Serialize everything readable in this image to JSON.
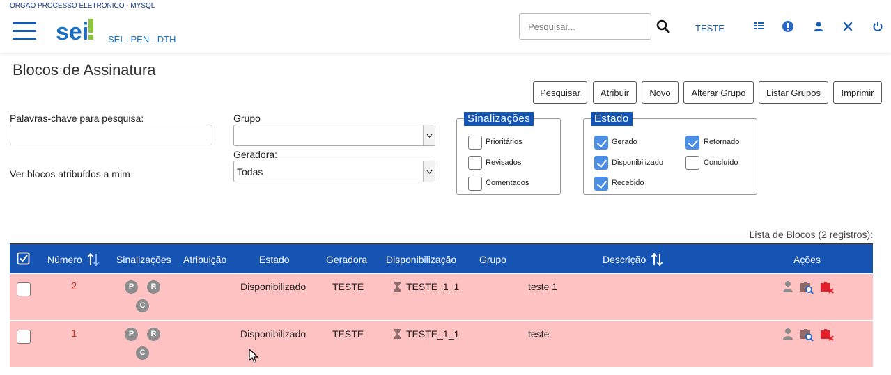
{
  "header": {
    "org": "ORGAO PROCESSO ELETRONICO - MYSQL",
    "logo_text": "sei!",
    "env": "SEI - PEN - DTH",
    "search_placeholder": "Pesquisar...",
    "user": "TESTE",
    "icons": [
      "menu-icon",
      "search-icon",
      "grid-icon",
      "alert-icon",
      "user-icon",
      "tools-icon",
      "power-icon"
    ]
  },
  "page": {
    "title": "Blocos de Assinatura"
  },
  "toolbar": {
    "pesquisar": "Pesquisar",
    "atribuir": "Atribuir",
    "novo": "Novo",
    "alterar_grupo": "Alterar Grupo",
    "listar_grupos": "Listar Grupos",
    "imprimir": "Imprimir"
  },
  "filters": {
    "keywords_label": "Palavras-chave para pesquisa:",
    "keywords_value": "",
    "grupo_label": "Grupo",
    "grupo_value": "",
    "geradora_label": "Geradora:",
    "geradora_value": "Todas",
    "ver_blocos": "Ver blocos atribuídos a mim"
  },
  "sinalizacoes": {
    "legend": "Sinalizações",
    "items": [
      {
        "label": "Prioritários",
        "checked": false
      },
      {
        "label": "Revisados",
        "checked": false
      },
      {
        "label": "Comentados",
        "checked": false
      }
    ]
  },
  "estado": {
    "legend": "Estado",
    "items": [
      {
        "label": "Gerado",
        "checked": true
      },
      {
        "label": "Disponibilizado",
        "checked": true
      },
      {
        "label": "Recebido",
        "checked": true
      },
      {
        "label": "Retornado",
        "checked": true
      },
      {
        "label": "Concluído",
        "checked": false
      }
    ]
  },
  "table": {
    "caption": "Lista de Blocos (2 registros):",
    "columns": [
      "Número",
      "Sinalizações",
      "Atribuição",
      "Estado",
      "Geradora",
      "Disponibilização",
      "Grupo",
      "Descrição",
      "Ações"
    ],
    "badges": [
      "P",
      "R",
      "C"
    ],
    "rows": [
      {
        "numero": "2",
        "atribuicao": "",
        "estado": "Disponibilizado",
        "geradora": "TESTE",
        "disponibilizacao": "TESTE_1_1",
        "grupo": "",
        "descricao": "teste 1"
      },
      {
        "numero": "1",
        "atribuicao": "",
        "estado": "Disponibilizado",
        "geradora": "TESTE",
        "disponibilizacao": "TESTE_1_1",
        "grupo": "",
        "descricao": "teste"
      }
    ]
  },
  "colors": {
    "primary": "#1554b3",
    "row_bg": "#ffc2c2",
    "number": "#c0392b",
    "delete": "#e0202a"
  }
}
